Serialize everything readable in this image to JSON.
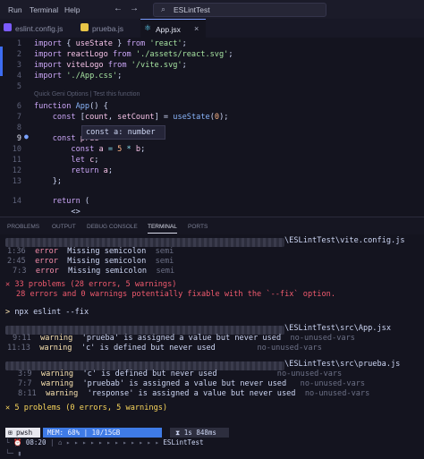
{
  "titlebar": {
    "menu": [
      "Run",
      "Terminal",
      "Help"
    ],
    "back": "←",
    "forward": "→",
    "search_text": "ESLintTest"
  },
  "tabs": [
    {
      "label": "eslint.config.js",
      "color": "#7c5cff"
    },
    {
      "label": "prueba.js",
      "color": "#e8c547"
    },
    {
      "label": "App.jsx",
      "color": "#61dafb"
    }
  ],
  "editor": {
    "line_numbers": [
      "1",
      "2",
      "3",
      "4",
      "5",
      "6",
      "7",
      "8",
      "9",
      "10",
      "11",
      "12",
      "13",
      "14"
    ],
    "lines": [
      [
        [
          "kw",
          "import "
        ],
        [
          "pl",
          "{ "
        ],
        [
          "var",
          "useState"
        ],
        [
          "pl",
          " } "
        ],
        [
          "kw",
          "from "
        ],
        [
          "str",
          "'react'"
        ],
        [
          "pl",
          ";"
        ]
      ],
      [
        [
          "kw",
          "import "
        ],
        [
          "var",
          "reactLogo "
        ],
        [
          "kw",
          "from "
        ],
        [
          "str",
          "'./assets/react.svg'"
        ],
        [
          "pl",
          ";"
        ]
      ],
      [
        [
          "kw",
          "import "
        ],
        [
          "var",
          "viteLogo "
        ],
        [
          "kw",
          "from "
        ],
        [
          "str",
          "'/vite.svg'"
        ],
        [
          "pl",
          ";"
        ]
      ],
      [
        [
          "kw",
          "import "
        ],
        [
          "str",
          "'./App.css'"
        ],
        [
          "pl",
          ";"
        ]
      ],
      [],
      [
        [
          "kw",
          "function "
        ],
        [
          "fn",
          "App"
        ],
        [
          "pl",
          "() {"
        ]
      ],
      [
        [
          "pl",
          "    "
        ],
        [
          "kw",
          "const "
        ],
        [
          "pl",
          "["
        ],
        [
          "var",
          "count"
        ],
        [
          "pl",
          ", "
        ],
        [
          "var",
          "setCount"
        ],
        [
          "pl",
          "] = "
        ],
        [
          "fn",
          "useState"
        ],
        [
          "pl",
          "("
        ],
        [
          "num",
          "0"
        ],
        [
          "pl",
          ");"
        ]
      ],
      [],
      [
        [
          "pl",
          "    "
        ],
        [
          "kw",
          "const "
        ],
        [
          "var",
          "prue"
        ]
      ],
      [
        [
          "pl",
          "        "
        ],
        [
          "kw",
          "const "
        ],
        [
          "var",
          "a "
        ],
        [
          "op",
          "= "
        ],
        [
          "num",
          "5 "
        ],
        [
          "op",
          "* "
        ],
        [
          "var",
          "b"
        ],
        [
          "pl",
          ";"
        ]
      ],
      [
        [
          "pl",
          "        "
        ],
        [
          "kw",
          "let "
        ],
        [
          "var",
          "c"
        ],
        [
          "pl",
          ";"
        ]
      ],
      [
        [
          "pl",
          "        "
        ],
        [
          "kw",
          "return "
        ],
        [
          "var",
          "a"
        ],
        [
          "pl",
          ";"
        ]
      ],
      [
        [
          "pl",
          "    };"
        ]
      ],
      [],
      [
        [
          "pl",
          "    "
        ],
        [
          "kw",
          "return "
        ],
        [
          "pl",
          "("
        ]
      ],
      [
        [
          "pl",
          "        <>"
        ]
      ]
    ],
    "codelens": "Quick Geni Options | Test this function",
    "tooltip": "const a: number"
  },
  "panel_tabs": [
    "PROBLEMS",
    "OUTPUT",
    "DEBUG CONSOLE",
    "TERMINAL",
    "PORTS"
  ],
  "terminal": {
    "path1": "\\ESLintTest\\vite.config.js",
    "errors1": [
      {
        "loc": "1:36",
        "sev": "error",
        "msg": "Missing semicolon",
        "rule": "semi"
      },
      {
        "loc": "2:45",
        "sev": "error",
        "msg": "Missing semicolon",
        "rule": "semi"
      },
      {
        "loc": "7:3",
        "sev": "error",
        "msg": "Missing semicolon",
        "rule": "semi"
      }
    ],
    "summary1": "✕ 33 problems (28 errors, 5 warnings)",
    "summary1b": "28 errors and 0 warnings potentially fixable with the `--fix` option.",
    "prompt_symbol": ">",
    "command": "npx eslint --fix",
    "path2": "\\ESLintTest\\src\\App.jsx",
    "warnings2": [
      {
        "loc": "9:11",
        "sev": "warning",
        "msg": "'prueba' is assigned a value but never used",
        "rule": "no-unused-vars"
      },
      {
        "loc": "11:13",
        "sev": "warning",
        "msg": "'c' is defined but never used",
        "rule": "no-unused-vars"
      }
    ],
    "path3": "\\ESLintTest\\src\\prueba.js",
    "warnings3": [
      {
        "loc": "3:9",
        "sev": "warning",
        "msg": "'c' is defined but never used",
        "rule": "no-unused-vars"
      },
      {
        "loc": "7:7",
        "sev": "warning",
        "msg": "'pruebab' is assigned a value but never used",
        "rule": "no-unused-vars"
      },
      {
        "loc": "8:11",
        "sev": "warning",
        "msg": "'response' is assigned a value but never used",
        "rule": "no-unused-vars"
      }
    ],
    "summary2": "✕ 5 problems (0 errors, 5 warnings)",
    "status": {
      "shell": "pwsh",
      "mem": "MEM: 68% | 10/15GB",
      "time_taken": "1s 848ms",
      "clock": "08:20",
      "dir": "ESLintTest"
    }
  }
}
